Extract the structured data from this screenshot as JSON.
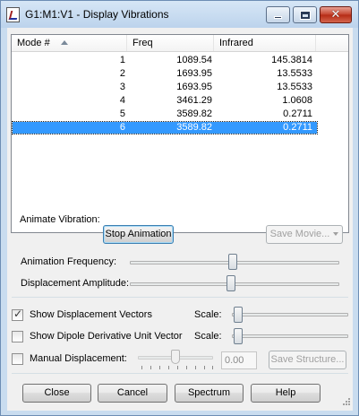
{
  "window": {
    "title": "G1:M1:V1 - Display Vibrations",
    "close_glyph": "✕"
  },
  "list": {
    "columns": [
      "Mode #",
      "Freq",
      "Infrared"
    ],
    "rows": [
      {
        "mode": "1",
        "freq": "1089.54",
        "ir": "145.3814"
      },
      {
        "mode": "2",
        "freq": "1693.95",
        "ir": "13.5533"
      },
      {
        "mode": "3",
        "freq": "1693.95",
        "ir": "13.5533"
      },
      {
        "mode": "4",
        "freq": "3461.29",
        "ir": "1.0608"
      },
      {
        "mode": "5",
        "freq": "3589.82",
        "ir": "0.2711"
      },
      {
        "mode": "6",
        "freq": "3589.82",
        "ir": "0.2711"
      }
    ],
    "selected_mode": "6"
  },
  "animate": {
    "label": "Animate Vibration:",
    "stop_button": "Stop Animation",
    "save_movie_button": "Save Movie...",
    "frequency_label": "Animation Frequency:",
    "frequency_level": 0.49,
    "amplitude_label": "Displacement Amplitude:",
    "amplitude_level": 0.48
  },
  "options": {
    "show_displacement": {
      "label": "Show Displacement Vectors",
      "checked": true,
      "scale_label": "Scale:",
      "scale_level": 0.02
    },
    "show_dipole": {
      "label": "Show Dipole Derivative Unit Vector",
      "checked": false,
      "scale_label": "Scale:",
      "scale_level": 0.02
    },
    "manual": {
      "label": "Manual Displacement:",
      "checked": false,
      "value": "0.00",
      "save_structure_button": "Save Structure...",
      "level": 0.5
    }
  },
  "buttons": {
    "close": "Close",
    "cancel": "Cancel",
    "spectrum": "Spectrum",
    "help": "Help"
  },
  "icons": {
    "app": "gaussview-app-icon",
    "sort": "sort-ascending-icon",
    "check": "checkmark-icon",
    "resize": "resize-grip-icon"
  }
}
